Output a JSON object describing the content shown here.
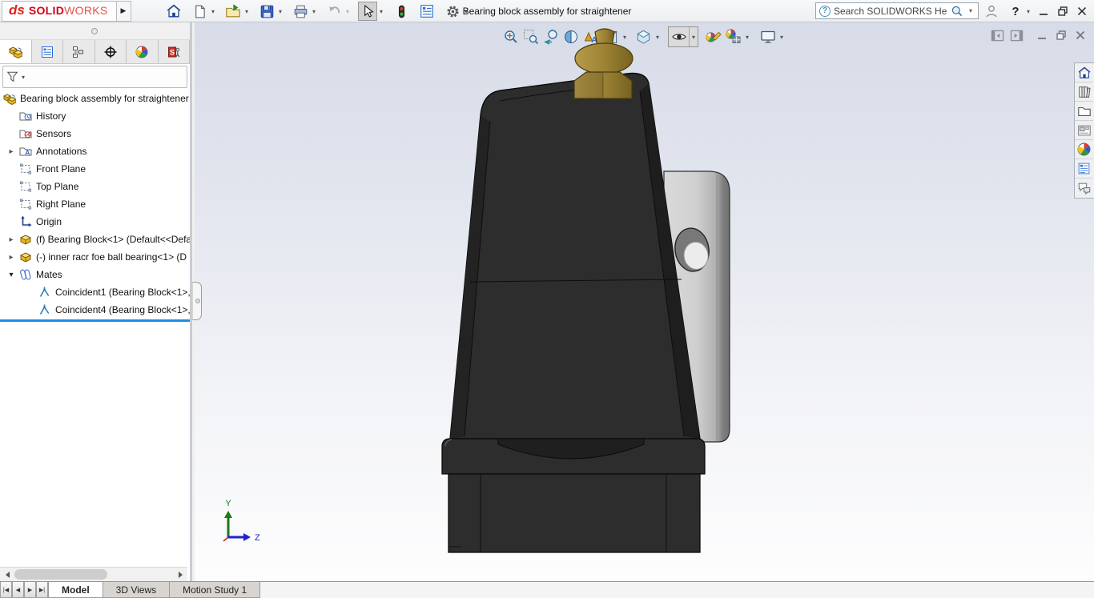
{
  "titlebar": {
    "logo_mark": "ds",
    "logo_solid": "SOLID",
    "logo_works": "WORKS",
    "title": "Bearing block assembly for straightener",
    "search_placeholder": "Search SOLIDWORKS Help",
    "tools": [
      "home",
      "new-document",
      "open",
      "save",
      "print",
      "undo",
      "select",
      "rebuild-lights",
      "display-pane",
      "options-gear"
    ]
  },
  "featuremanager": {
    "tabs": [
      "featuremanager-design-tree",
      "property-manager",
      "configuration-manager",
      "dimxpert-manager",
      "display-manager",
      "cam-manager"
    ],
    "tree": [
      {
        "label": "Bearing block assembly for straightener",
        "icon": "assembly-icon",
        "level": 0,
        "expand": "none"
      },
      {
        "label": "History",
        "icon": "history-folder-icon",
        "level": 1,
        "expand": "none"
      },
      {
        "label": "Sensors",
        "icon": "sensors-folder-icon",
        "level": 1,
        "expand": "none"
      },
      {
        "label": "Annotations",
        "icon": "annotations-folder-icon",
        "level": 1,
        "expand": "collapsed"
      },
      {
        "label": "Front Plane",
        "icon": "plane-icon",
        "level": 1,
        "expand": "none"
      },
      {
        "label": "Top Plane",
        "icon": "plane-icon",
        "level": 1,
        "expand": "none"
      },
      {
        "label": "Right Plane",
        "icon": "plane-icon",
        "level": 1,
        "expand": "none"
      },
      {
        "label": "Origin",
        "icon": "origin-icon",
        "level": 1,
        "expand": "none"
      },
      {
        "label": "(f) Bearing Block<1> (Default<<Defa",
        "icon": "part-icon",
        "level": 1,
        "expand": "collapsed"
      },
      {
        "label": "(-) inner racr foe ball bearing<1> (D",
        "icon": "part-icon",
        "level": 1,
        "expand": "collapsed"
      },
      {
        "label": "Mates",
        "icon": "mates-icon",
        "level": 1,
        "expand": "expanded"
      },
      {
        "label": "Coincident1 (Bearing Block<1>,",
        "icon": "coincident-mate-icon",
        "level": 2,
        "expand": "none"
      },
      {
        "label": "Coincident4 (Bearing Block<1>,",
        "icon": "coincident-mate-icon",
        "level": 2,
        "expand": "none"
      }
    ]
  },
  "viewport": {
    "headsup_tools": [
      "zoom-to-fit",
      "zoom-to-area",
      "previous-view",
      "section-view",
      "dynamic-annotation-views",
      "view-orientation",
      "display-style",
      "hide-show-items",
      "edit-appearance",
      "apply-scene",
      "view-settings"
    ],
    "doc_window_controls": [
      "collapse-left-pane",
      "collapse-right-pane",
      "minimize",
      "restore",
      "close"
    ],
    "triad": {
      "y_label": "Y",
      "z_label": "Z"
    }
  },
  "taskpane": {
    "tools": [
      "solidworks-resources",
      "design-library",
      "file-explorer",
      "view-palette",
      "appearances-scenes",
      "custom-properties",
      "solidworks-forum"
    ]
  },
  "bottom": {
    "tabs": [
      {
        "label": "Model",
        "active": true
      },
      {
        "label": "3D Views",
        "active": false
      },
      {
        "label": "Motion Study 1",
        "active": false
      }
    ]
  },
  "colors": {
    "logo_red": "#d6001c",
    "rollback_blue": "#1e8fe0",
    "body_dark": "#2d2d2d",
    "brass": "#a08436",
    "race_gray": "#c6c6c6",
    "viewport_top": "#d7dce8",
    "viewport_bottom": "#fdfdfd"
  }
}
